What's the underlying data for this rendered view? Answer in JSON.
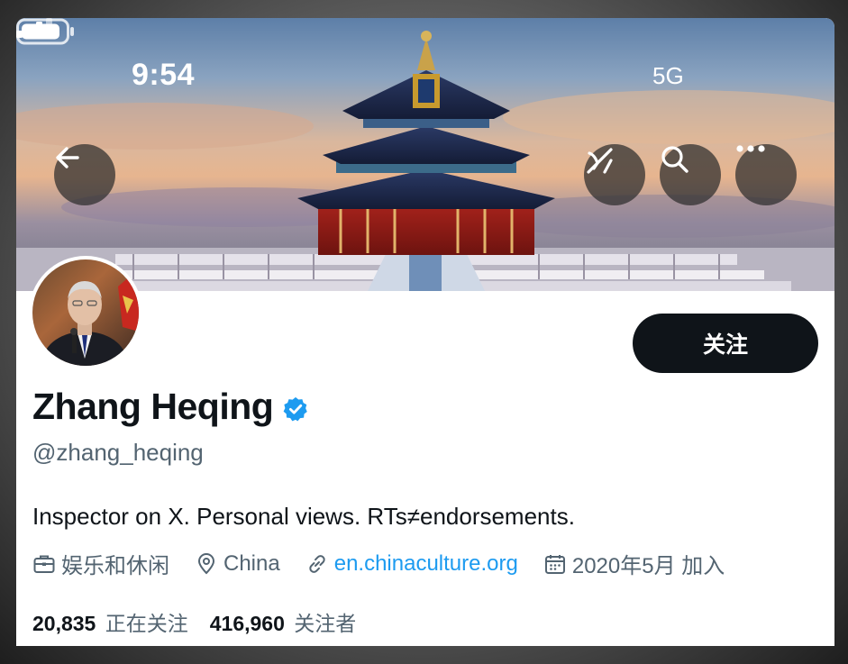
{
  "status_bar": {
    "time": "9:54",
    "network": "5G"
  },
  "header": {
    "back_icon": "back-arrow-icon",
    "grok_icon": "grok-icon",
    "search_icon": "search-icon",
    "more_icon": "more-icon"
  },
  "profile": {
    "follow_label": "关注",
    "name": "Zhang Heqing",
    "verified": true,
    "handle": "@zhang_heqing",
    "bio": "Inspector on X. Personal views. RTs≠endorsements.",
    "category": "娱乐和休闲",
    "location": "China",
    "website": "en.chinaculture.org",
    "joined": "2020年5月 加入",
    "following_count": "20,835",
    "following_label": "正在关注",
    "followers_count": "416,960",
    "followers_label": "关注者"
  },
  "colors": {
    "accent": "#1d9bf0",
    "text_primary": "#0f1419",
    "text_secondary": "#536471",
    "button_dark": "#0f1419"
  }
}
